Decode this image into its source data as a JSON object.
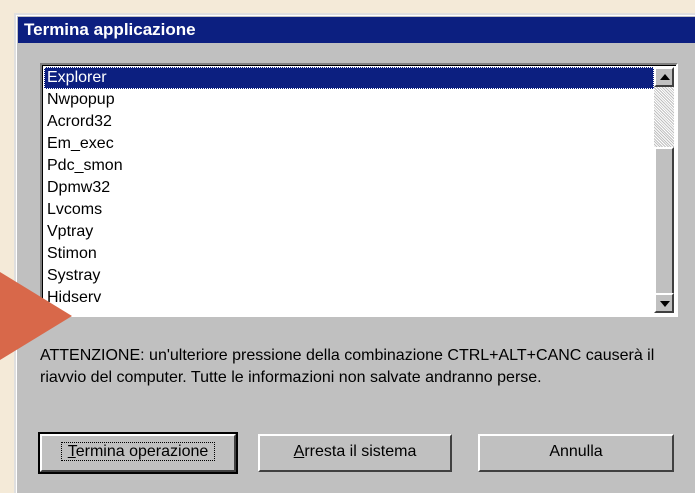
{
  "window": {
    "title": "Termina applicazione"
  },
  "processes": [
    "Explorer",
    "Nwpopup",
    "Acrord32",
    "Em_exec",
    "Pdc_smon",
    "Dpmw32",
    "Lvcoms",
    "Vptray",
    "Stimon",
    "Systray",
    "Hidserv"
  ],
  "selected_index": 0,
  "warning": "ATTENZIONE: un'ulteriore pressione della combinazione CTRL+ALT+CANC causerà il riavvio del computer. Tutte le informazioni non salvate andranno perse.",
  "buttons": {
    "end_task": {
      "mnemonic": "T",
      "rest": "ermina operazione"
    },
    "shutdown": {
      "mnemonic": "A",
      "rest": "rresta il sistema"
    },
    "cancel": "Annulla"
  },
  "colors": {
    "title_bar": "#0c1f80",
    "selection": "#0c1f80",
    "dialog_face": "#c0c0c0",
    "background": "#f4ead8",
    "arrow": "#d8684a"
  }
}
